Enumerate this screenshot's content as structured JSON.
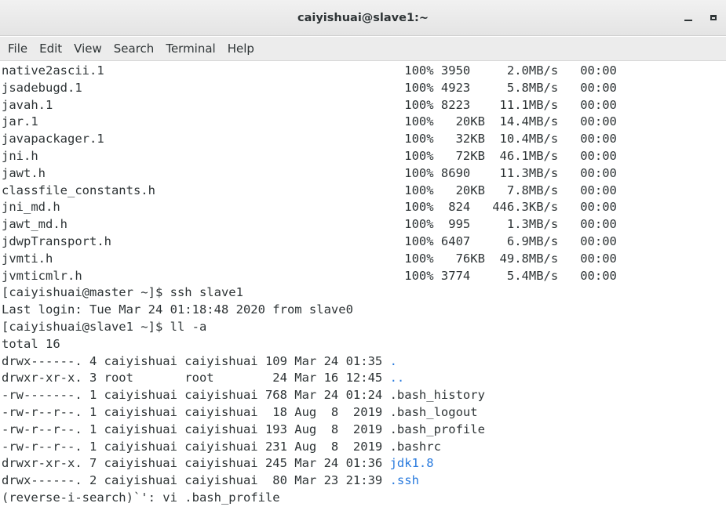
{
  "window": {
    "title": "caiyishuai@slave1:~"
  },
  "menu": {
    "items": [
      "File",
      "Edit",
      "View",
      "Search",
      "Terminal",
      "Help"
    ]
  },
  "colors": {
    "directory": "#2a7bde",
    "text": "#2e3436",
    "background": "#ffffff"
  },
  "terminal": {
    "lines": [
      {
        "text": "native2ascii.1                                         100% 3950     2.0MB/s   00:00"
      },
      {
        "text": "jsadebugd.1                                            100% 4923     5.8MB/s   00:00"
      },
      {
        "text": "javah.1                                                100% 8223    11.1MB/s   00:00"
      },
      {
        "text": "jar.1                                                  100%   20KB  14.4MB/s   00:00"
      },
      {
        "text": "javapackager.1                                         100%   32KB  10.4MB/s   00:00"
      },
      {
        "text": "jni.h                                                  100%   72KB  46.1MB/s   00:00"
      },
      {
        "text": "jawt.h                                                 100% 8690    11.3MB/s   00:00"
      },
      {
        "text": "classfile_constants.h                                  100%   20KB   7.8MB/s   00:00"
      },
      {
        "text": "jni_md.h                                               100%  824   446.3KB/s   00:00"
      },
      {
        "text": "jawt_md.h                                              100%  995     1.3MB/s   00:00"
      },
      {
        "text": "jdwpTransport.h                                        100% 6407     6.9MB/s   00:00"
      },
      {
        "text": "jvmti.h                                                100%   76KB  49.8MB/s   00:00"
      },
      {
        "text": "jvmticmlr.h                                            100% 3774     5.4MB/s   00:00"
      },
      {
        "text": "[caiyishuai@master ~]$ ssh slave1"
      },
      {
        "text": "Last login: Tue Mar 24 01:18:48 2020 from slave0"
      },
      {
        "text": "[caiyishuai@slave1 ~]$ ll -a"
      },
      {
        "text": "total 16"
      },
      {
        "text": "drwx------. 4 caiyishuai caiyishuai 109 Mar 24 01:35 ",
        "name": ".",
        "dir": true
      },
      {
        "text": "drwxr-xr-x. 3 root       root        24 Mar 16 12:45 ",
        "name": "..",
        "dir": true
      },
      {
        "text": "-rw-------. 1 caiyishuai caiyishuai 768 Mar 24 01:24 ",
        "name": ".bash_history"
      },
      {
        "text": "-rw-r--r--. 1 caiyishuai caiyishuai  18 Aug  8  2019 ",
        "name": ".bash_logout"
      },
      {
        "text": "-rw-r--r--. 1 caiyishuai caiyishuai 193 Aug  8  2019 ",
        "name": ".bash_profile"
      },
      {
        "text": "-rw-r--r--. 1 caiyishuai caiyishuai 231 Aug  8  2019 ",
        "name": ".bashrc"
      },
      {
        "text": "drwxr-xr-x. 7 caiyishuai caiyishuai 245 Mar 24 01:36 ",
        "name": "jdk1.8",
        "dir": true
      },
      {
        "text": "drwx------. 2 caiyishuai caiyishuai  80 Mar 23 21:39 ",
        "name": ".ssh",
        "dir": true
      },
      {
        "text": "(reverse-i-search)`': vi .bash_profile"
      }
    ]
  }
}
